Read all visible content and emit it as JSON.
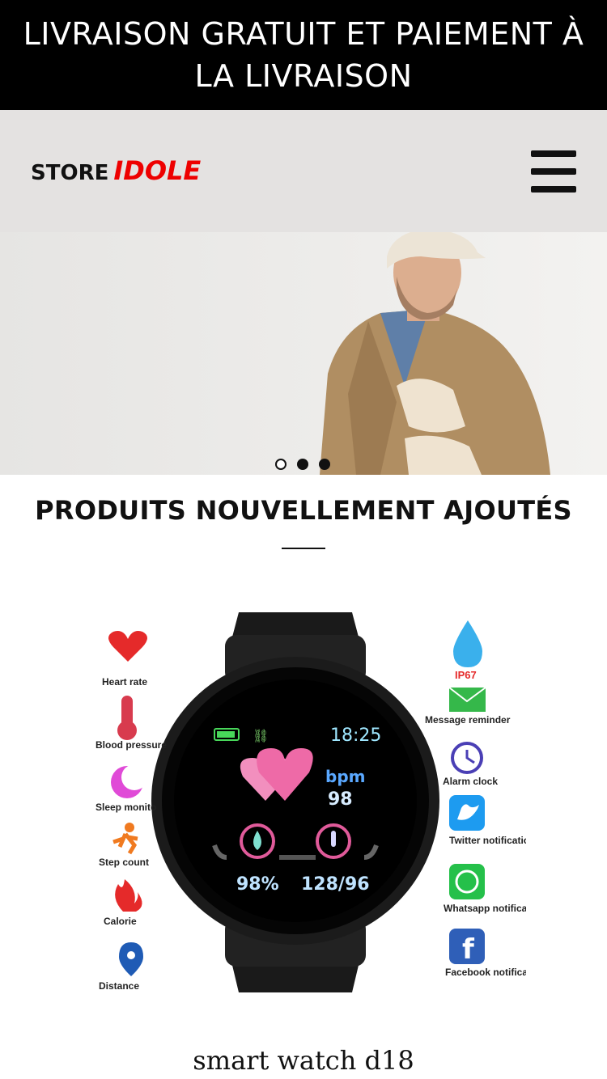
{
  "announcement": {
    "text": "LIVRAISON GRATUIT ET PAIEMENT À LA LIVRAISON"
  },
  "header": {
    "logo_store": "STORE",
    "logo_brand": "IDOLE",
    "menu_icon": "hamburger-menu-icon",
    "colors": {
      "brand": "#e00000",
      "header_bg": "#e4e2e1"
    }
  },
  "hero": {
    "slide_count": 3,
    "active_slide": 1
  },
  "section": {
    "title": "PRODUITS NOUVELLEMENT AJOUTÉS"
  },
  "product": {
    "name": "smart watch d18",
    "watch_screen": {
      "time": "18:25",
      "bpm_label": "bpm",
      "bpm_value": "98",
      "oxygen": "98%",
      "blood_pressure": "128/96"
    },
    "features_left": [
      "Heart rate",
      "Blood pressure",
      "Sleep monito",
      "Step count",
      "Calorie",
      "Distance"
    ],
    "features_right": [
      "IP67",
      "Message reminder",
      "Alarm clock",
      "Twitter notification",
      "Whatsapp notification",
      "Facebook notification"
    ]
  }
}
